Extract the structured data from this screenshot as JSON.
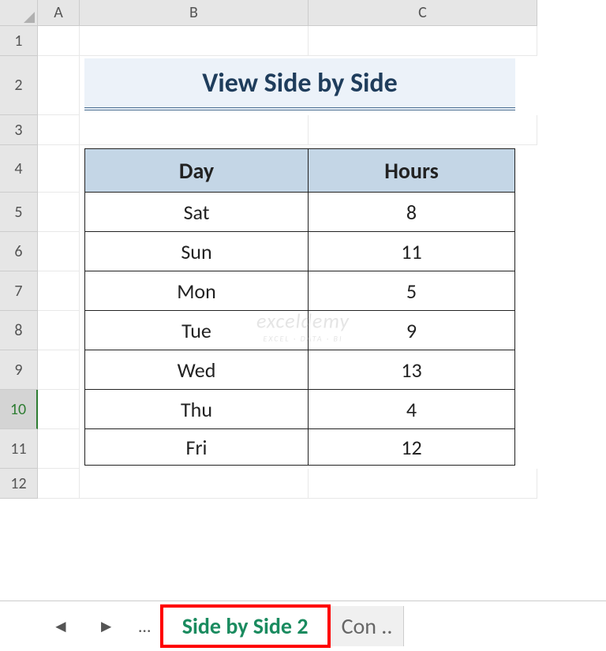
{
  "columns": [
    "A",
    "B",
    "C"
  ],
  "rows": [
    "1",
    "2",
    "3",
    "4",
    "5",
    "6",
    "7",
    "8",
    "9",
    "10",
    "11",
    "12"
  ],
  "selectedRow": "10",
  "title": "View Side by Side",
  "table": {
    "headers": [
      "Day",
      "Hours"
    ],
    "data": [
      {
        "day": "Sat",
        "hours": "8"
      },
      {
        "day": "Sun",
        "hours": "11"
      },
      {
        "day": "Mon",
        "hours": "5"
      },
      {
        "day": "Tue",
        "hours": "9"
      },
      {
        "day": "Wed",
        "hours": "13"
      },
      {
        "day": "Thu",
        "hours": "4"
      },
      {
        "day": "Fri",
        "hours": "12"
      }
    ]
  },
  "tabs": {
    "nav_prev": "◄",
    "nav_next": "►",
    "ellipsis": "…",
    "active": "Side by Side 2",
    "other": "Con .."
  },
  "watermark": {
    "main": "exceldemy",
    "sub": "EXCEL · DATA · BI"
  }
}
